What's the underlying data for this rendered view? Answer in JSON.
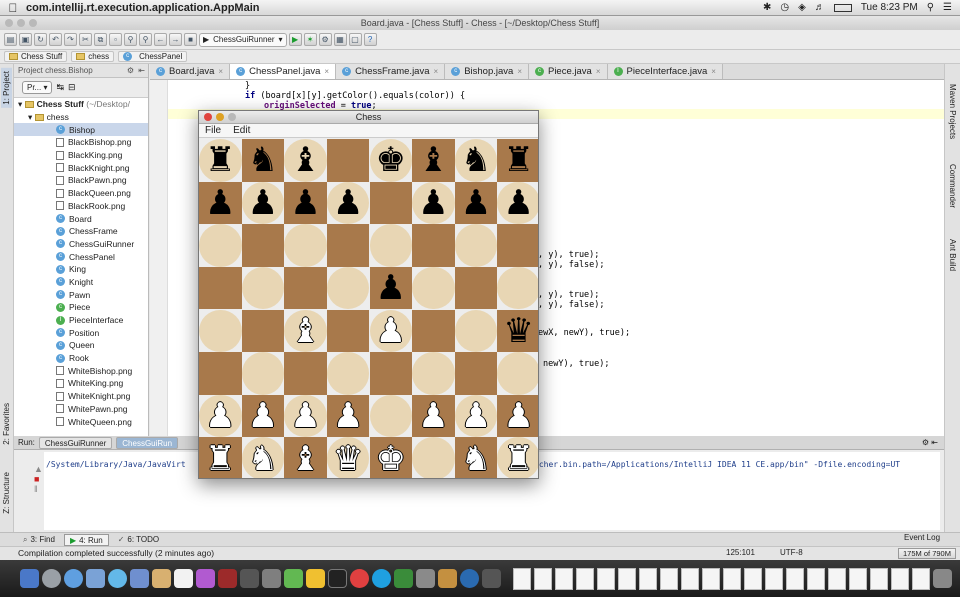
{
  "menubar": {
    "app_name": "com.intellij.rt.execution.application.AppMain",
    "clock": "Tue 8:23 PM"
  },
  "window": {
    "title": "Board.java - [Chess Stuff] - Chess - [~/Desktop/Chess Stuff]"
  },
  "toolbar": {
    "run_config": "ChessGuiRunner"
  },
  "breadcrumbs": [
    "Chess Stuff",
    "chess",
    "ChessPanel"
  ],
  "left_strip": {
    "project_tab": "1: Project",
    "favorites_tab": "2: Favorites",
    "structure_tab": "Z: Structure"
  },
  "right_strip": {
    "maven": "Maven Projects",
    "commander": "Commander",
    "ant": "Ant Build"
  },
  "project_panel": {
    "header": "Project chess.Bishop",
    "view_select": "Pr...",
    "root": "Chess Stuff",
    "root_path": "(~/Desktop/",
    "package": "chess",
    "items": [
      {
        "name": "Bishop",
        "kind": "class",
        "selected": true
      },
      {
        "name": "BlackBishop.png",
        "kind": "png"
      },
      {
        "name": "BlackKing.png",
        "kind": "png"
      },
      {
        "name": "BlackKnight.png",
        "kind": "png"
      },
      {
        "name": "BlackPawn.png",
        "kind": "png"
      },
      {
        "name": "BlackQueen.png",
        "kind": "png"
      },
      {
        "name": "BlackRook.png",
        "kind": "png"
      },
      {
        "name": "Board",
        "kind": "class"
      },
      {
        "name": "ChessFrame",
        "kind": "class"
      },
      {
        "name": "ChessGuiRunner",
        "kind": "class"
      },
      {
        "name": "ChessPanel",
        "kind": "class"
      },
      {
        "name": "King",
        "kind": "class"
      },
      {
        "name": "Knight",
        "kind": "class"
      },
      {
        "name": "Pawn",
        "kind": "class"
      },
      {
        "name": "Piece",
        "kind": "abstract"
      },
      {
        "name": "PieceInterface",
        "kind": "interface"
      },
      {
        "name": "Position",
        "kind": "class"
      },
      {
        "name": "Queen",
        "kind": "class"
      },
      {
        "name": "Rook",
        "kind": "class"
      },
      {
        "name": "WhiteBishop.png",
        "kind": "png"
      },
      {
        "name": "WhiteKing.png",
        "kind": "png"
      },
      {
        "name": "WhiteKnight.png",
        "kind": "png"
      },
      {
        "name": "WhitePawn.png",
        "kind": "png"
      },
      {
        "name": "WhiteQueen.png",
        "kind": "png"
      }
    ]
  },
  "editor_tabs": [
    {
      "label": "Board.java",
      "active": false
    },
    {
      "label": "ChessPanel.java",
      "active": true
    },
    {
      "label": "ChessFrame.java",
      "active": false
    },
    {
      "label": "Bishop.java",
      "active": false
    },
    {
      "label": "Piece.java",
      "active": false
    },
    {
      "label": "PieceInterface.java",
      "active": false
    }
  ],
  "code": {
    "brace": "}",
    "if_kw": "if",
    "if_rest": " (board[x][y].getColor().equals(color)) {",
    "field": "originSelected",
    "assign": " = ",
    "true_kw": "true",
    "semi": ";",
    "frag1": ", y), true);",
    "frag2": ", y), false);",
    "frag3": ", y), true);",
    "frag4": ", y), false);",
    "frag5": "ewX, newY), true);",
    "frag6": "newY), true);"
  },
  "run_panel": {
    "label": "Run:",
    "tabs": [
      {
        "label": "ChessGuiRunner",
        "active": false
      },
      {
        "label": "ChessGuiRun",
        "active": true
      }
    ],
    "console_left": "/System/Library/Java/JavaVirt",
    "console_right": "Didea.launcher.bin.path=/Applications/IntelliJ IDEA 11 CE.app/bin\" -Dfile.encoding=UT"
  },
  "bottom_tabs": [
    {
      "label": "3: Find",
      "active": false
    },
    {
      "label": "4: Run",
      "active": true
    },
    {
      "label": "6: TODO",
      "active": false
    }
  ],
  "event_log": "Event Log",
  "status": {
    "message": "Compilation completed successfully (2 minutes ago)",
    "position": "125:101",
    "encoding": "UTF-8",
    "memory": "175M of 790M"
  },
  "chess_window": {
    "title": "Chess",
    "menu": [
      "File",
      "Edit"
    ],
    "board": [
      [
        "bR",
        "bN",
        "bB",
        "",
        "bK",
        "bB",
        "bN",
        "bR"
      ],
      [
        "bP",
        "bP",
        "bP",
        "bP",
        "",
        "bP",
        "bP",
        "bP"
      ],
      [
        "",
        "",
        "",
        "",
        "",
        "",
        "",
        ""
      ],
      [
        "",
        "",
        "",
        "",
        "bP",
        "",
        "",
        ""
      ],
      [
        "",
        "",
        "wB",
        "",
        "wP",
        "",
        "",
        "bQ"
      ],
      [
        "",
        "",
        "",
        "",
        "",
        "",
        "",
        ""
      ],
      [
        "wP",
        "wP",
        "wP",
        "wP",
        "",
        "wP",
        "wP",
        "wP"
      ],
      [
        "wR",
        "wN",
        "wB",
        "wQ",
        "wK",
        "",
        "wN",
        "wR"
      ]
    ],
    "light_color": "#e8d6b4",
    "dark_color": "#a8794b"
  }
}
